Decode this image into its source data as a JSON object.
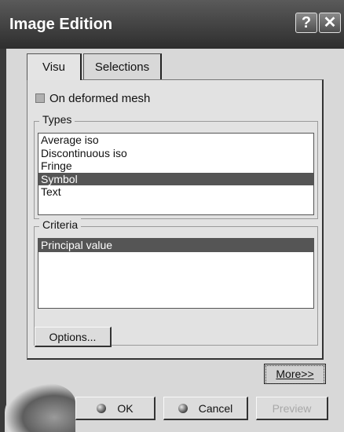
{
  "window": {
    "title": "Image Edition"
  },
  "title_buttons": {
    "help": "?",
    "close": "✕"
  },
  "tabs": [
    {
      "label": "Visu",
      "active": true
    },
    {
      "label": "Selections",
      "active": false
    }
  ],
  "deformed_mesh": {
    "label": "On deformed mesh",
    "checked": false
  },
  "types": {
    "label": "Types",
    "items": [
      "Average iso",
      "Discontinuous iso",
      "Fringe",
      "Symbol",
      "Text"
    ],
    "selected": "Symbol"
  },
  "criteria": {
    "label": "Criteria",
    "items": [
      "Principal value"
    ],
    "selected": "Principal value"
  },
  "buttons": {
    "options": "Options...",
    "more": "More>>",
    "ok": "OK",
    "cancel": "Cancel",
    "preview": "Preview"
  },
  "icons": {
    "help": "help-icon",
    "close": "close-icon",
    "ok": "ok-ball-icon",
    "cancel": "cancel-ball-icon"
  }
}
